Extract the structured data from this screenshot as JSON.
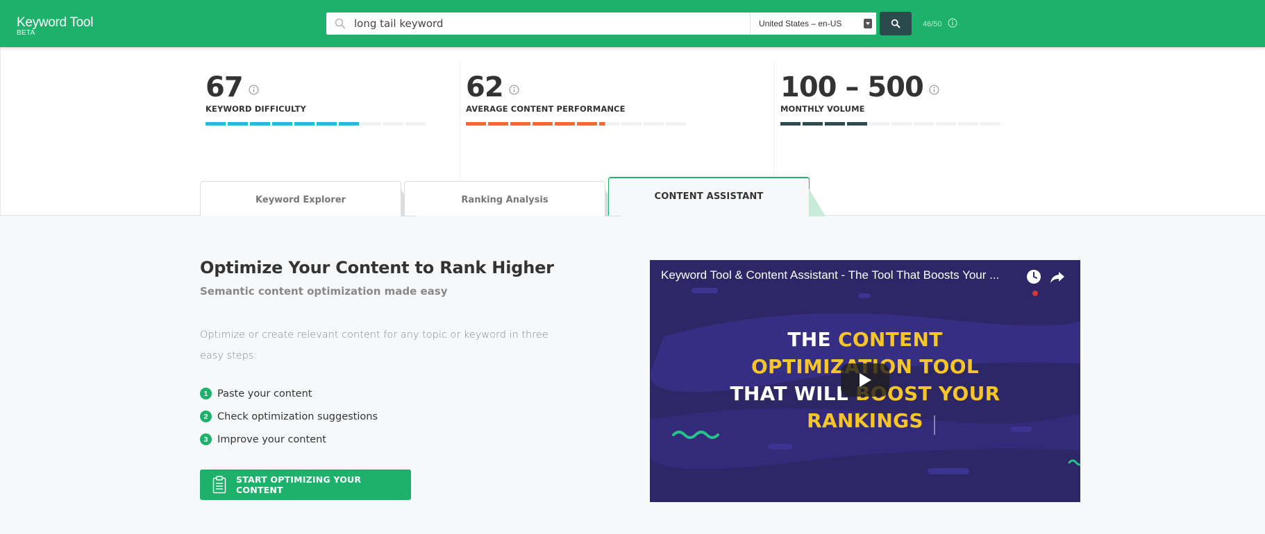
{
  "header": {
    "logo_name": "Keyword Tool",
    "logo_sub": "BETA",
    "search_value": "long tail keyword",
    "country": "United States – en-US",
    "quota": "46/50"
  },
  "metrics": [
    {
      "value": "67",
      "label": "KEYWORD DIFFICULTY",
      "color": "#2bb6de",
      "filled": 7,
      "total": 10
    },
    {
      "value": "62",
      "label": "AVERAGE CONTENT PERFORMANCE",
      "color": "#f06a35",
      "filled": 6.3,
      "total": 10
    },
    {
      "value": "100 – 500",
      "label": "MONTHLY VOLUME",
      "color": "#2f4a4c",
      "filled": 4,
      "total": 10
    }
  ],
  "tabs": [
    {
      "label": "Keyword Explorer"
    },
    {
      "label": "Ranking Analysis"
    },
    {
      "label": "CONTENT ASSISTANT",
      "active": true
    }
  ],
  "content": {
    "title": "Optimize Your Content to Rank Higher",
    "subtitle": "Semantic content optimization made easy",
    "description": "Optimize or create relevant content for any topic or keyword in three easy steps:",
    "steps": [
      {
        "num": "1",
        "text": "Paste your content"
      },
      {
        "num": "2",
        "text": "Check optimization suggestions"
      },
      {
        "num": "3",
        "text": "Improve your content"
      }
    ],
    "cta_label": "START OPTIMIZING YOUR CONTENT"
  },
  "video": {
    "title": "Keyword Tool & Content Assistant - The Tool That Boosts Your ...",
    "line1_white": "THE ",
    "line1_yellow": "CONTENT",
    "line2_yellow": "OPTIMIZATION TOOL",
    "line3_white": "THAT WILL ",
    "line3_yellow": "BOOST YOUR",
    "line4_yellow": "RANKINGS"
  },
  "colors": {
    "brand": "#1db16b",
    "search_button": "#2a4a4c",
    "video_bg": "#2d2767",
    "video_accent": "#f6c527"
  }
}
